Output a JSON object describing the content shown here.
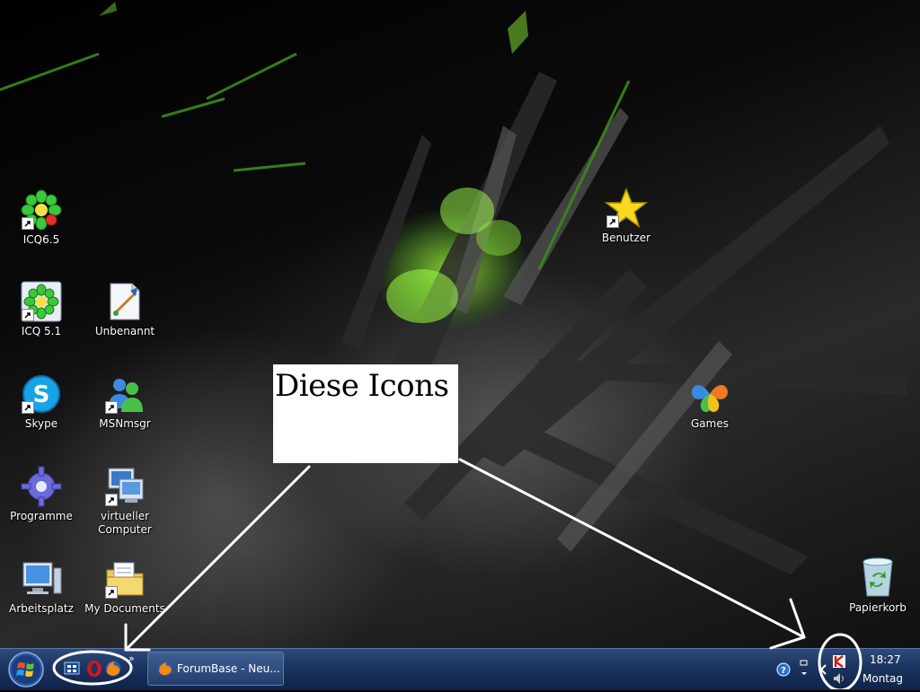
{
  "desktop": {
    "icons": [
      {
        "label": "ICQ6.5",
        "icon": "icq-flower-icon"
      },
      {
        "label": "ICQ 5.1",
        "icon": "icq-flower-icon"
      },
      {
        "label": "Unbenannt",
        "icon": "paint-document-icon"
      },
      {
        "label": "Skype",
        "icon": "skype-icon"
      },
      {
        "label": "MSNmsgr",
        "icon": "msn-messenger-icon"
      },
      {
        "label": "Programme",
        "icon": "gear-icon"
      },
      {
        "label": "virtueller Computer",
        "icon": "virtual-computer-icon"
      },
      {
        "label": "Arbeitsplatz",
        "icon": "computer-icon"
      },
      {
        "label": "My Documents",
        "icon": "documents-folder-icon"
      },
      {
        "label": "Benutzer",
        "icon": "star-icon"
      },
      {
        "label": "Games",
        "icon": "games-icon"
      },
      {
        "label": "Papierkorb",
        "icon": "recycle-bin-icon"
      }
    ]
  },
  "annotation": {
    "text": "Diese Icons"
  },
  "taskbar": {
    "start_icon": "windows-orb-icon",
    "quick_launch": [
      "show-desktop-icon",
      "opera-icon",
      "firefox-icon"
    ],
    "overflow": "»",
    "task_button": {
      "label": "ForumBase - Neu...",
      "icon": "firefox-icon"
    },
    "tray_icons": [
      "help-icon",
      "monitor-icon",
      "expand-icon",
      "antivirus-icon",
      "speaker-icon"
    ],
    "clock": {
      "time": "18:27",
      "day": "Montag"
    }
  },
  "colors": {
    "taskbar": "#1d3562",
    "annotation_box": "#ffffff",
    "wallpaper_accent": "#7cff2a"
  }
}
